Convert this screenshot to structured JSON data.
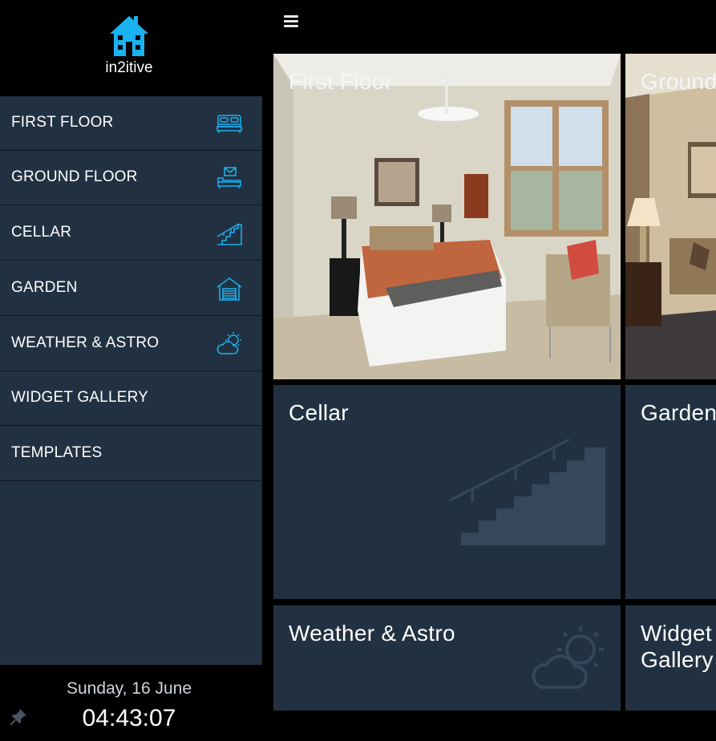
{
  "brand": {
    "name": "in2itive",
    "icon": "house-icon",
    "accent": "#1ab2f0"
  },
  "sidebar": {
    "items": [
      {
        "label": "FIRST FLOOR",
        "icon": "bed-icon"
      },
      {
        "label": "GROUND FLOOR",
        "icon": "sofa-icon"
      },
      {
        "label": "CELLAR",
        "icon": "stairs-icon"
      },
      {
        "label": "GARDEN",
        "icon": "garage-icon"
      },
      {
        "label": "WEATHER & ASTRO",
        "icon": "cloud-sun-icon"
      },
      {
        "label": "WIDGET GALLERY",
        "icon": ""
      },
      {
        "label": "TEMPLATES",
        "icon": ""
      }
    ]
  },
  "footer": {
    "date": "Sunday, 16 June",
    "time": "04:43:07",
    "pin_icon": "pin-icon"
  },
  "topbar": {
    "menu_icon": "hamburger-menu-icon"
  },
  "tiles": [
    {
      "title": "First Floor",
      "kind": "photo-bedroom"
    },
    {
      "title": "Ground",
      "kind": "photo-living"
    },
    {
      "title": "Cellar",
      "icon": "stairs-icon"
    },
    {
      "title": "Garden",
      "icon": ""
    },
    {
      "title": "Weather & Astro",
      "icon": "cloud-sun-icon"
    },
    {
      "title": "Widget Gallery",
      "icon": ""
    }
  ],
  "colors": {
    "panel": "#223142",
    "background": "#000000",
    "icon_ghost": "#34475b"
  }
}
